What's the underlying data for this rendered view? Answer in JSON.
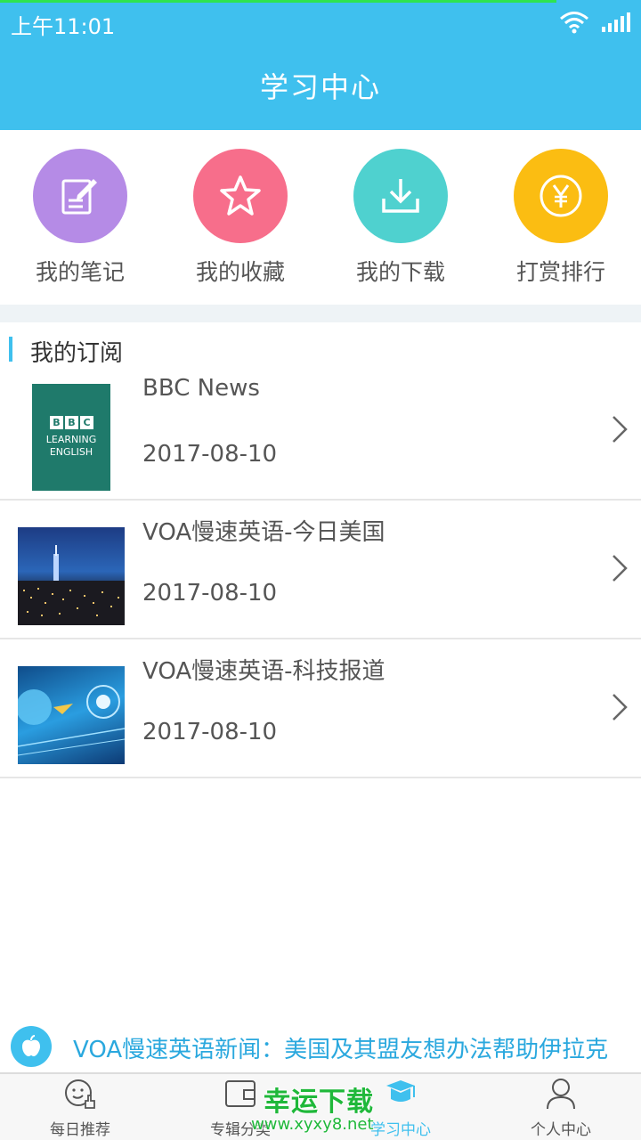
{
  "status_bar": {
    "time": "上午11:01"
  },
  "header": {
    "title": "学习中心"
  },
  "quick_actions": [
    {
      "label": "我的笔记",
      "icon": "note-edit-icon",
      "color": "#b58be6"
    },
    {
      "label": "我的收藏",
      "icon": "star-icon",
      "color": "#f76e8b"
    },
    {
      "label": "我的下载",
      "icon": "download-icon",
      "color": "#4fd1cf"
    },
    {
      "label": "打赏排行",
      "icon": "yen-coin-icon",
      "color": "#fbbd12"
    }
  ],
  "subscriptions": {
    "title": "我的订阅",
    "items": [
      {
        "name": "BBC News",
        "date": "2017-08-10",
        "thumb_text": [
          "LEARNING",
          "ENGLISH"
        ],
        "thumb_logo": [
          "B",
          "B",
          "C"
        ]
      },
      {
        "name": "VOA慢速英语-今日美国",
        "date": "2017-08-10"
      },
      {
        "name": "VOA慢速英语-科技报道",
        "date": "2017-08-10"
      }
    ]
  },
  "ticker": {
    "text": "VOA慢速英语新闻：美国及其盟友想办法帮助伊拉克"
  },
  "tabs": [
    {
      "label": "每日推荐",
      "icon": "daily-recommend-icon",
      "active": false
    },
    {
      "label": "专辑分类",
      "icon": "album-folder-icon",
      "active": false
    },
    {
      "label": "学习中心",
      "icon": "graduation-cap-icon",
      "active": true
    },
    {
      "label": "个人中心",
      "icon": "user-icon",
      "active": false
    }
  ],
  "watermark": {
    "line1": "幸运下载",
    "line2": "www.xyxy8.net"
  },
  "colors": {
    "accent": "#3fc0ee",
    "active_tab": "#3fc0ee",
    "ticker_text": "#2aa8de"
  }
}
